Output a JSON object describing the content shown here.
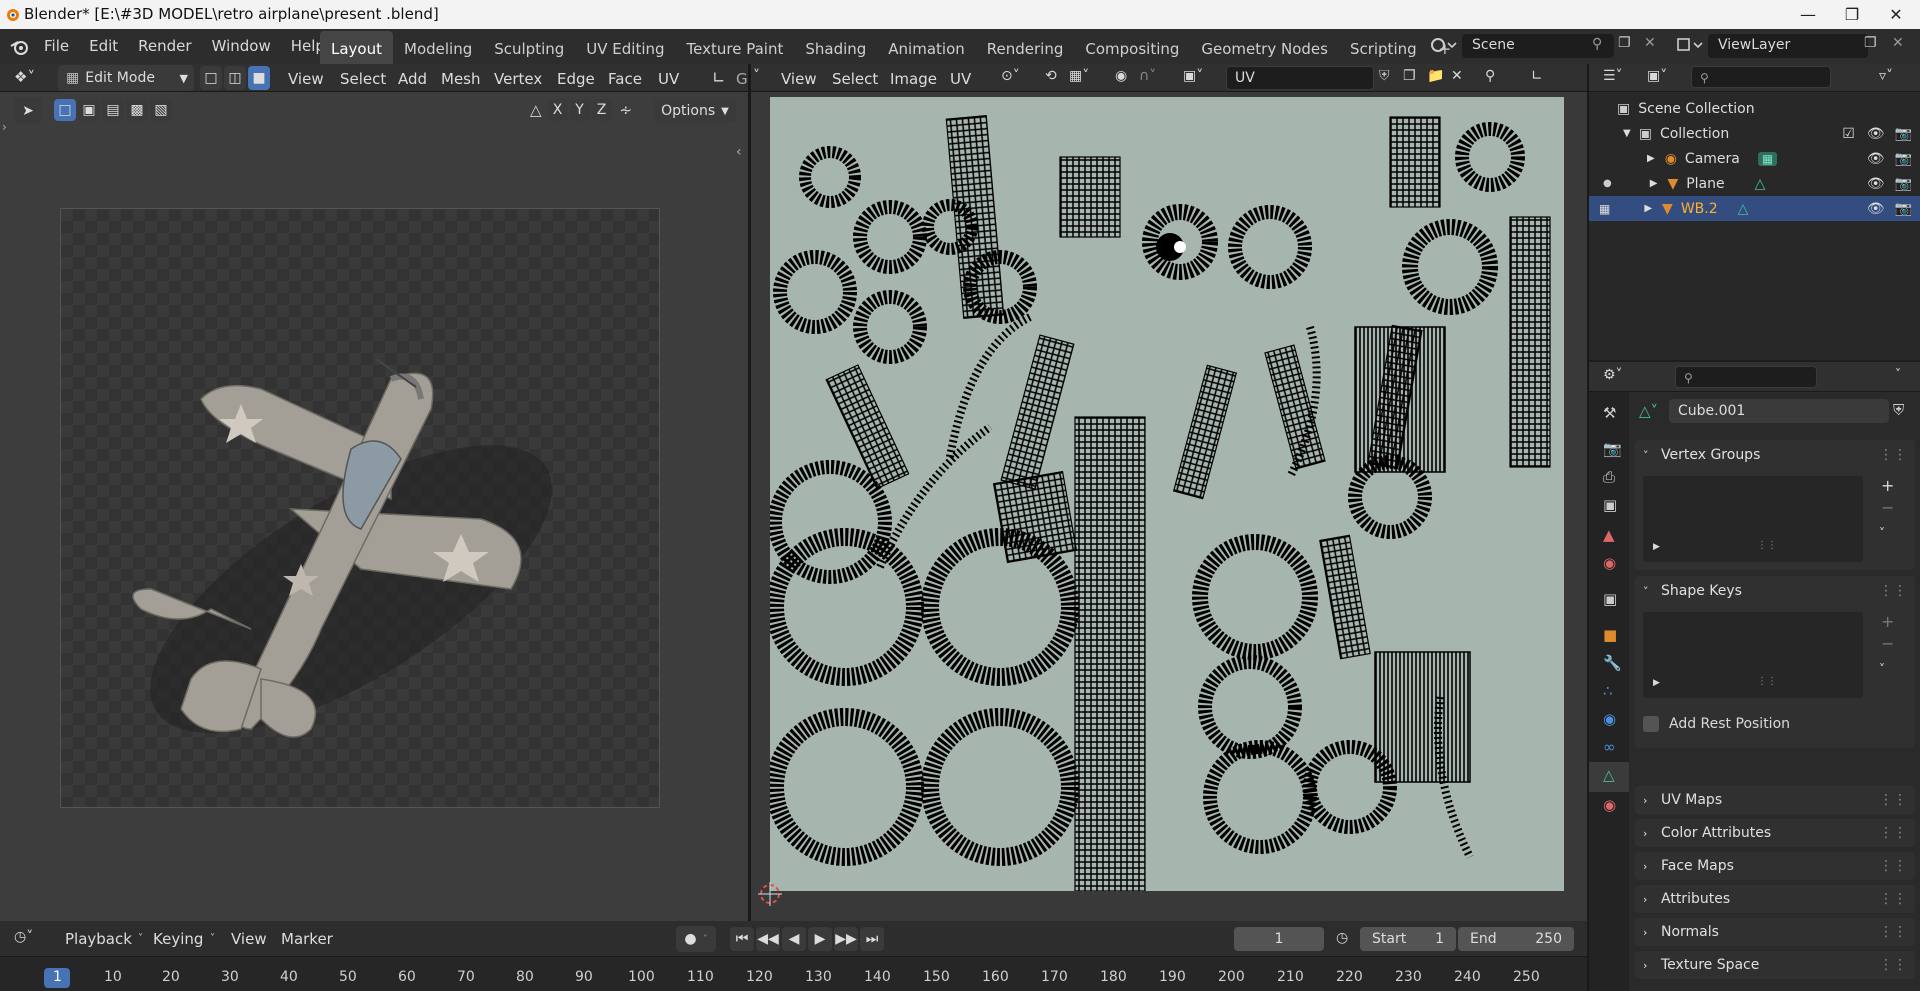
{
  "window": {
    "title": "Blender* [E:\\#3D MODEL\\retro airplane\\present .blend]"
  },
  "menubar": {
    "items": [
      "File",
      "Edit",
      "Render",
      "Window",
      "Help"
    ]
  },
  "workspaces": [
    "Layout",
    "Modeling",
    "Sculpting",
    "UV Editing",
    "Texture Paint",
    "Shading",
    "Animation",
    "Rendering",
    "Compositing",
    "Geometry Nodes",
    "Scripting"
  ],
  "active_workspace": "Layout",
  "add_workspace": "+",
  "scene": {
    "label": "Scene"
  },
  "viewlayer": {
    "label": "ViewLayer"
  },
  "viewport": {
    "mode": "Edit Mode",
    "menus": [
      "View",
      "Select",
      "Add",
      "Mesh",
      "Vertex",
      "Edge",
      "Face",
      "UV"
    ],
    "axes": [
      "X",
      "Y",
      "Z"
    ],
    "options_label": "Options",
    "clipped_text": "G"
  },
  "uv_editor": {
    "menus": [
      "View",
      "Select",
      "Image",
      "UV"
    ],
    "image_name": "UV"
  },
  "outliner": {
    "root": "Scene Collection",
    "collection": "Collection",
    "items": [
      {
        "name": "Camera",
        "icon": "camera-icon"
      },
      {
        "name": "Plane",
        "icon": "mesh-icon"
      },
      {
        "name": "WB.2",
        "icon": "mesh-icon",
        "selected": true
      }
    ]
  },
  "properties": {
    "object_name": "Cube.001",
    "panels": {
      "vertex_groups": "Vertex Groups",
      "shape_keys": "Shape Keys",
      "add_rest_position": "Add Rest Position",
      "uv_maps": "UV Maps",
      "color_attributes": "Color Attributes",
      "face_maps": "Face Maps",
      "attributes": "Attributes",
      "normals": "Normals",
      "texture_space": "Texture Space"
    }
  },
  "timeline": {
    "menus": [
      "Playback",
      "Keying",
      "View",
      "Marker"
    ],
    "current_frame": "1",
    "start_label": "Start",
    "start": "1",
    "end_label": "End",
    "end": "250",
    "ticks": [
      "1",
      "10",
      "20",
      "30",
      "40",
      "50",
      "60",
      "70",
      "80",
      "90",
      "100",
      "110",
      "120",
      "130",
      "140",
      "150",
      "160",
      "170",
      "180",
      "190",
      "200",
      "210",
      "220",
      "230",
      "240",
      "250"
    ]
  },
  "colors": {
    "accent": "#4772b3",
    "uv_bg": "#a6b5ad",
    "selected_row": "#334d80",
    "orange": "#e08b2b"
  }
}
